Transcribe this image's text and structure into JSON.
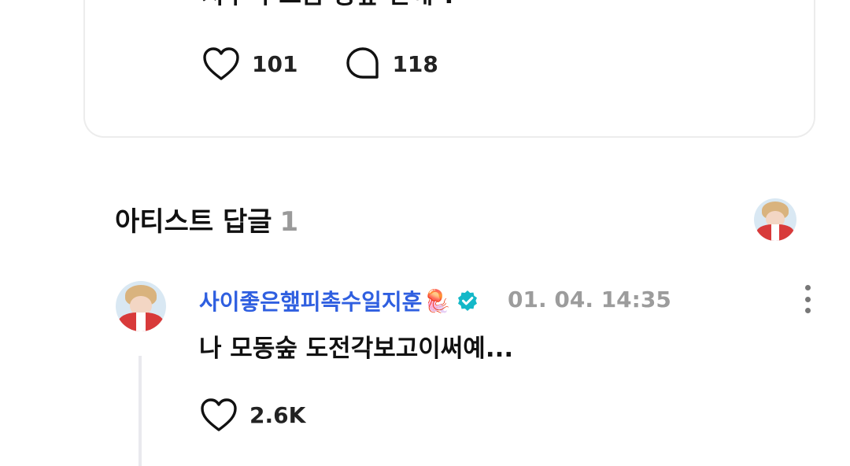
{
  "post": {
    "text": "지후니 요즘 동숲 안해 ?",
    "likes": "101",
    "comments": "118"
  },
  "artist_replies": {
    "title": "아티스트 답글",
    "count": "1"
  },
  "reply": {
    "author": "사이좋은햎피촉수일지훈",
    "author_emoji": "🪼",
    "time": "01. 04. 14:35",
    "text": "나 모동숲 도전각보고이써예...",
    "likes": "2.6K"
  },
  "icons": [
    "heart-icon",
    "comment-bubble-icon",
    "verified-badge-icon",
    "more-vertical-icon"
  ],
  "colors": {
    "author_name": "#2f5fe0",
    "verified_badge": "#14b8c8",
    "muted_text": "#9c9c9c"
  }
}
